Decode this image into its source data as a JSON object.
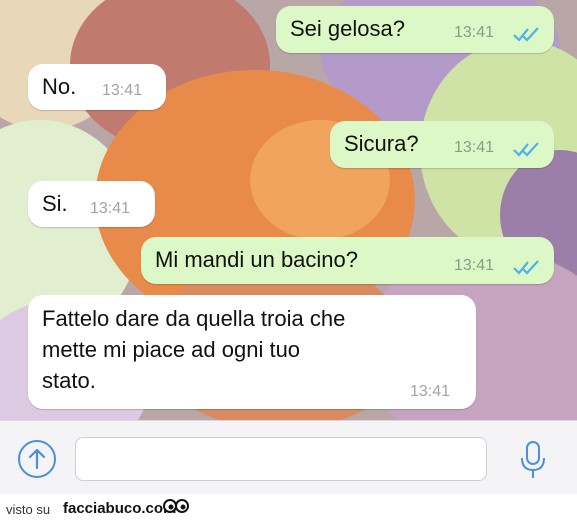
{
  "messages": [
    {
      "direction": "out",
      "text": "Sei gelosa?",
      "time": "13:41",
      "status": "read"
    },
    {
      "direction": "in",
      "text": "No.",
      "time": "13:41"
    },
    {
      "direction": "out",
      "text": "Sicura?",
      "time": "13:41",
      "status": "read"
    },
    {
      "direction": "in",
      "text": "Si.",
      "time": "13:41"
    },
    {
      "direction": "out",
      "text": "Mi mandi un bacino?",
      "time": "13:41",
      "status": "read"
    },
    {
      "direction": "in",
      "lines": [
        "Fattelo dare da quella troia che",
        "mette mi piace ad ogni tuo",
        "stato."
      ],
      "time": "13:41"
    }
  ],
  "composer": {
    "placeholder": "",
    "attach_icon": "arrow-up-circle-icon",
    "mic_icon": "microphone-icon"
  },
  "footer": {
    "visto": "visto su",
    "brand": "facciabuco.com",
    "logo_icon": "eyes-logo-icon"
  },
  "colors": {
    "outgoing": "#dcf8c6",
    "incoming": "#ffffff",
    "accent": "#4a90d9",
    "read_check": "#4fb3e8"
  }
}
